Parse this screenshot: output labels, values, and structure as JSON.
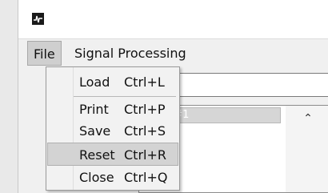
{
  "window": {
    "icon": "app-icon"
  },
  "menubar": {
    "file_label": "File",
    "signal_processing_label": "Signal Processing"
  },
  "file_menu": {
    "items": [
      {
        "label": "Load",
        "shortcut": "Ctrl+L"
      },
      {
        "label": "Print",
        "shortcut": "Ctrl+P"
      },
      {
        "label": "Save",
        "shortcut": "Ctrl+S"
      },
      {
        "label": "Reset",
        "shortcut": "Ctrl+R"
      },
      {
        "label": "Close",
        "shortcut": "Ctrl+Q"
      }
    ],
    "highlighted": "Reset"
  },
  "listbox": {
    "selected_item_visible_text": "bject #1"
  },
  "colors": {
    "menubar_bg": "#f0f0f0",
    "menu_highlight": "#d3d3d3",
    "active_menu": "#cfcfcf"
  }
}
